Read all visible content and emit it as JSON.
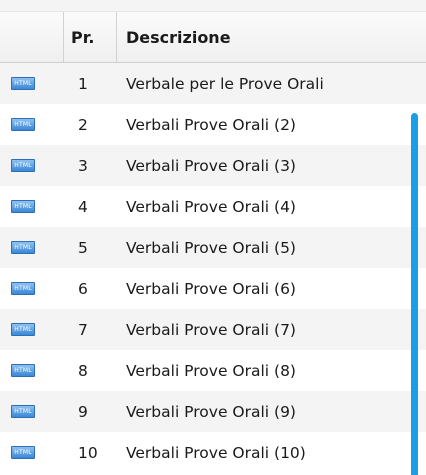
{
  "table": {
    "headers": {
      "icon": "",
      "pr": "Pr.",
      "description": "Descrizione"
    },
    "rows": [
      {
        "icon": "html-file-icon",
        "pr": "1",
        "description": "Verbale per le Prove Orali"
      },
      {
        "icon": "html-file-icon",
        "pr": "2",
        "description": "Verbali Prove Orali (2)"
      },
      {
        "icon": "html-file-icon",
        "pr": "3",
        "description": "Verbali Prove Orali (3)"
      },
      {
        "icon": "html-file-icon",
        "pr": "4",
        "description": "Verbali Prove Orali (4)"
      },
      {
        "icon": "html-file-icon",
        "pr": "5",
        "description": "Verbali Prove Orali (5)"
      },
      {
        "icon": "html-file-icon",
        "pr": "6",
        "description": "Verbali Prove Orali (6)"
      },
      {
        "icon": "html-file-icon",
        "pr": "7",
        "description": "Verbali Prove Orali (7)"
      },
      {
        "icon": "html-file-icon",
        "pr": "8",
        "description": "Verbali Prove Orali (8)"
      },
      {
        "icon": "html-file-icon",
        "pr": "9",
        "description": "Verbali Prove Orali (9)"
      },
      {
        "icon": "html-file-icon",
        "pr": "10",
        "description": "Verbali Prove Orali (10)"
      }
    ]
  },
  "colors": {
    "scrollbar": "#1a9ee6",
    "row_alt": "#f4f4f4",
    "icon": "#3b87d6"
  }
}
